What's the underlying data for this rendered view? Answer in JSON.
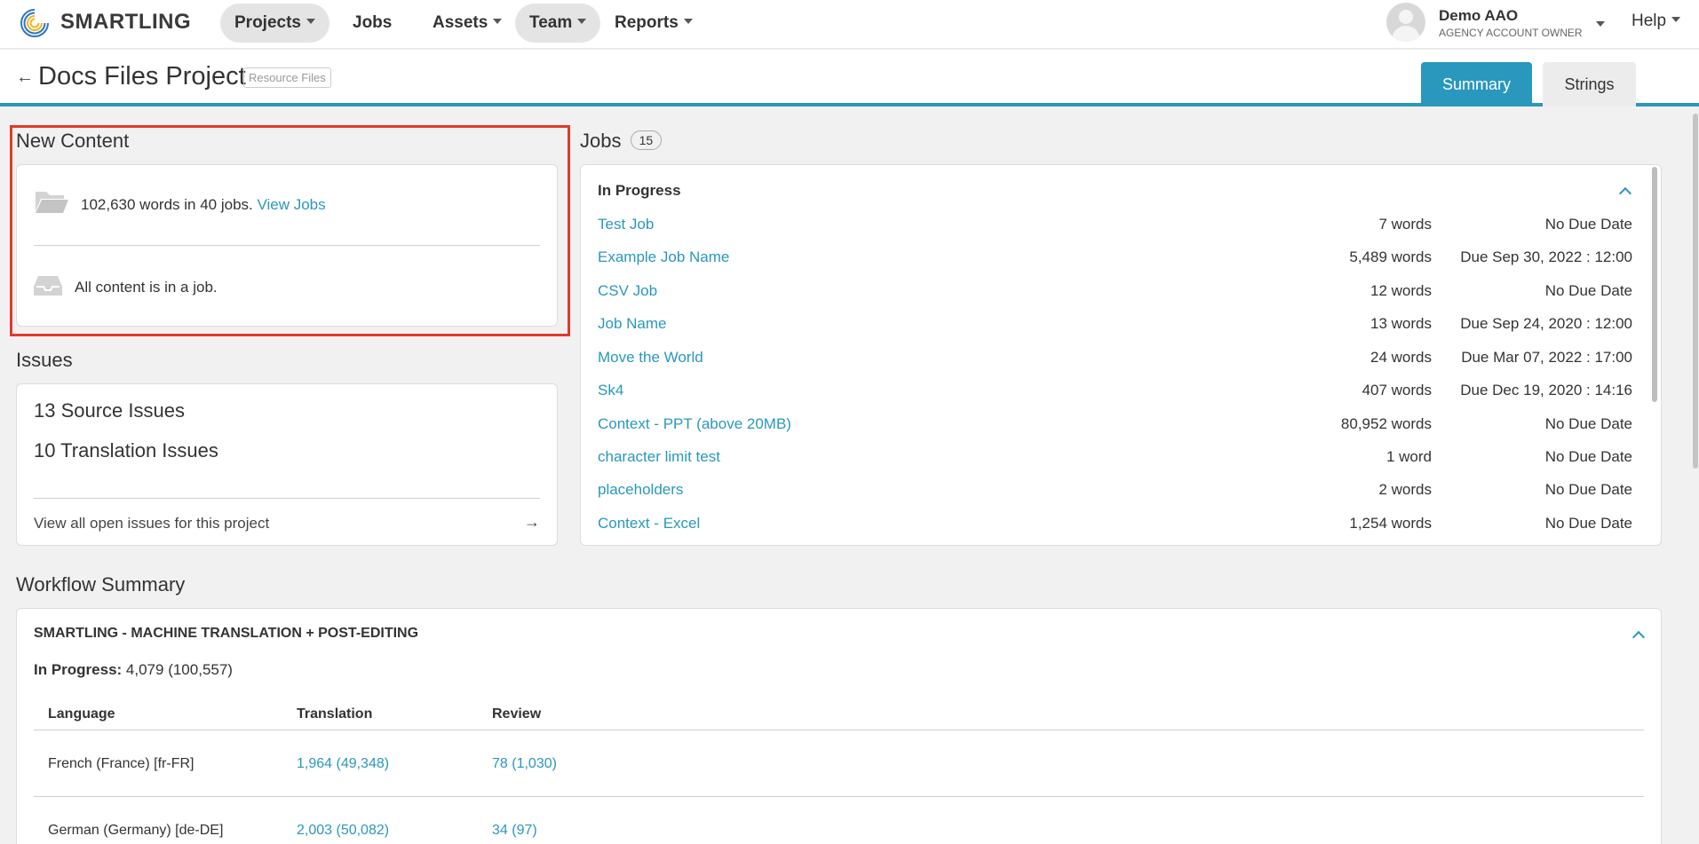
{
  "nav": {
    "logo_text": "SMARTLING",
    "items": [
      {
        "label": "Projects",
        "dropdown": true,
        "active": true
      },
      {
        "label": "Jobs",
        "dropdown": false,
        "active": false
      },
      {
        "label": "Assets",
        "dropdown": true,
        "active": false
      },
      {
        "label": "Team",
        "dropdown": true,
        "active": false
      },
      {
        "label": "Reports",
        "dropdown": true,
        "active": false
      }
    ],
    "user": {
      "name": "Demo AAO",
      "role": "AGENCY ACCOUNT OWNER"
    },
    "help": "Help"
  },
  "project": {
    "title": "Docs Files Project",
    "badge": "Resource Files",
    "tabs": [
      {
        "label": "Summary",
        "active": true
      },
      {
        "label": "Strings",
        "active": false
      }
    ]
  },
  "new_content": {
    "title": "New Content",
    "words_text": "102,630 words in 40 jobs. ",
    "view_jobs": "View Jobs",
    "status": "All content is in a job."
  },
  "issues": {
    "title": "Issues",
    "source": "13 Source Issues",
    "translation": "10 Translation Issues",
    "view_all": "View all open issues for this project"
  },
  "jobs": {
    "title": "Jobs",
    "count": "15",
    "group": "In Progress",
    "rows": [
      {
        "name": "Test Job",
        "words": "7 words",
        "due": "No Due Date"
      },
      {
        "name": "Example Job Name",
        "words": "5,489 words",
        "due": "Due Sep 30, 2022 : 12:00"
      },
      {
        "name": "CSV Job",
        "words": "12 words",
        "due": "No Due Date"
      },
      {
        "name": "Job Name",
        "words": "13 words",
        "due": "Due Sep 24, 2020 : 12:00"
      },
      {
        "name": "Move the World",
        "words": "24 words",
        "due": "Due Mar 07, 2022 : 17:00"
      },
      {
        "name": "Sk4",
        "words": "407 words",
        "due": "Due Dec 19, 2020 : 14:16"
      },
      {
        "name": "Context - PPT (above 20MB)",
        "words": "80,952 words",
        "due": "No Due Date"
      },
      {
        "name": "character limit test",
        "words": "1 word",
        "due": "No Due Date"
      },
      {
        "name": "placeholders",
        "words": "2 words",
        "due": "No Due Date"
      },
      {
        "name": "Context - Excel",
        "words": "1,254 words",
        "due": "No Due Date"
      }
    ]
  },
  "workflow": {
    "title": "Workflow Summary",
    "name": "SMARTLING - MACHINE TRANSLATION + POST-EDITING",
    "progress_label": "In Progress:",
    "progress_value": " 4,079 (100,557)",
    "headers": {
      "language": "Language",
      "translation": "Translation",
      "review": "Review"
    },
    "rows": [
      {
        "language": "French (France) [fr-FR]",
        "translation": "1,964  (49,348)",
        "review": "78  (1,030)"
      },
      {
        "language": "German (Germany) [de-DE]",
        "translation": "2,003  (50,082)",
        "review": "34  (97)"
      }
    ]
  },
  "colors": {
    "accent": "#2a97bd",
    "highlight": "#e2392b"
  }
}
